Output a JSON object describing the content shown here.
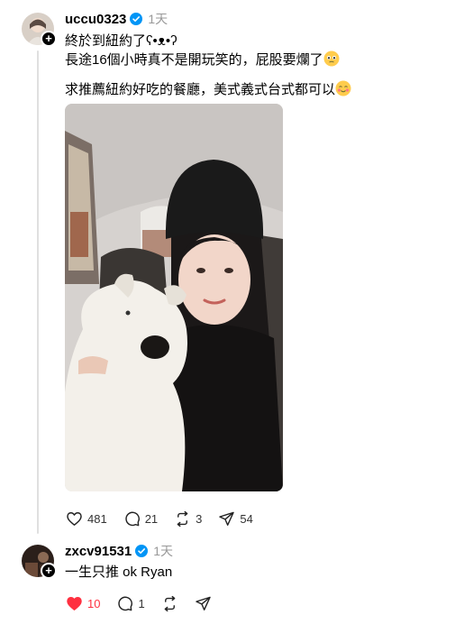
{
  "post": {
    "username": "uccu0323",
    "time": "1天",
    "line1": "終於到紐約了ʕ•ᴥ•ʔ",
    "line2": "長途16個小時真不是開玩笑的，屁股要爛了",
    "line3": "求推薦紐約好吃的餐廳，美式義式台式都可以",
    "stats": {
      "likes": "481",
      "comments": "21",
      "reposts": "3",
      "shares": "54"
    }
  },
  "reply": {
    "username": "zxcv91531",
    "time": "1天",
    "text": "一生只推 ok Ryan",
    "stats": {
      "likes": "10",
      "comments": "1"
    }
  },
  "colors": {
    "liked": "#ff3040",
    "verified": "#0095f6",
    "muted": "#999999"
  }
}
